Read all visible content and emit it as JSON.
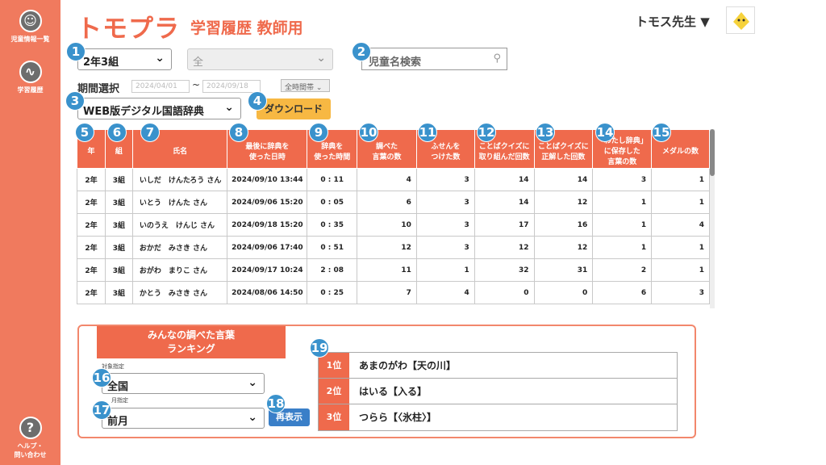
{
  "sidebar": {
    "items": [
      {
        "label": "児童情報一覧",
        "icon": "smile-icon"
      },
      {
        "label": "学習履歴",
        "icon": "chart-icon"
      }
    ],
    "help_label_1": "ヘルプ・",
    "help_label_2": "問い合わせ"
  },
  "header": {
    "logo": "トモプラ",
    "subtitle": "学習履歴 教師用",
    "teacher": "トモス先生 ▼"
  },
  "filters": {
    "class_select": "2年3組",
    "sub_select": "全",
    "search_placeholder": "児童名検索",
    "period_label": "期間選択",
    "date_from": "2024/04/01",
    "tilde": "~",
    "date_to": "2024/09/18",
    "alltime": "全時間帯",
    "dictionary_select": "WEB版デジタル国語辞典",
    "download_label": "ダウンロード"
  },
  "badges": [
    "1",
    "2",
    "3",
    "4",
    "5",
    "6",
    "7",
    "8",
    "9",
    "10",
    "11",
    "12",
    "13",
    "14",
    "15",
    "16",
    "17",
    "18",
    "19"
  ],
  "table": {
    "headers": [
      "年",
      "組",
      "氏名",
      "最後に辞典を\n使った日時",
      "辞典を\n使った時間",
      "調べた\n言葉の数",
      "ふせんを\nつけた数",
      "ことばクイズに\n取り組んだ回数",
      "ことばクイズに\n正解した回数",
      "「わたし辞典」\nに保存した\n言葉の数",
      "メダルの数"
    ],
    "rows": [
      [
        "2年",
        "3組",
        "いしだ　けんたろう さん",
        "2024/09/10 13:44",
        "0 : 11",
        "4",
        "3",
        "14",
        "14",
        "3",
        "1"
      ],
      [
        "2年",
        "3組",
        "いとう　けんた さん",
        "2024/09/06 15:20",
        "0 : 05",
        "6",
        "3",
        "14",
        "12",
        "1",
        "1"
      ],
      [
        "2年",
        "3組",
        "いのうえ　けんじ さん",
        "2024/09/18 15:20",
        "0 : 35",
        "10",
        "3",
        "17",
        "16",
        "1",
        "4"
      ],
      [
        "2年",
        "3組",
        "おかだ　みさき さん",
        "2024/09/06 17:40",
        "0 : 51",
        "12",
        "3",
        "12",
        "12",
        "1",
        "1"
      ],
      [
        "2年",
        "3組",
        "おがわ　まりこ さん",
        "2024/09/17 10:24",
        "2 : 08",
        "11",
        "1",
        "32",
        "31",
        "2",
        "1"
      ],
      [
        "2年",
        "3組",
        "かとう　みさき さん",
        "2024/08/06 14:50",
        "0 : 25",
        "7",
        "4",
        "0",
        "0",
        "6",
        "3"
      ]
    ]
  },
  "ranking": {
    "title_1": "みんなの調べた言葉",
    "title_2": "ランキング",
    "target_label": "対象指定",
    "target_select": "全国",
    "month_label": "月指定",
    "month_select": "前月",
    "redisplay_label": "再表示",
    "items": [
      {
        "rank": "1位",
        "word": "あまのがわ【天の川】"
      },
      {
        "rank": "2位",
        "word": "はいる【入る】"
      },
      {
        "rank": "3位",
        "word": "つらら【〈氷柱〉】"
      }
    ]
  },
  "colors": {
    "accent": "#ef6a4c",
    "sidebar": "#f07a5e",
    "badge": "#3a92cc",
    "button": "#f7b843"
  }
}
